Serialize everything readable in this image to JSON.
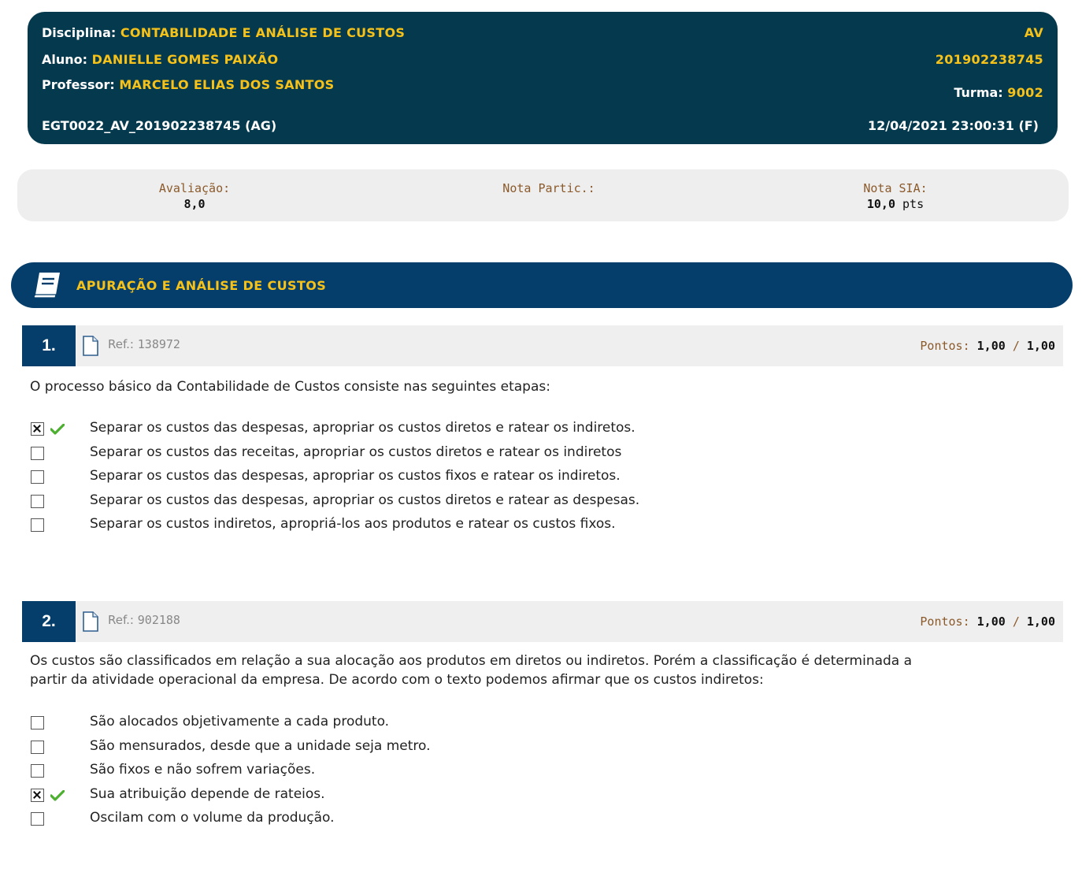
{
  "header": {
    "disciplina_label": "Disciplina:",
    "disciplina": "CONTABILIDADE E ANÁLISE DE CUSTOS",
    "aluno_label": "Aluno:",
    "aluno": "DANIELLE GOMES PAIXÃO",
    "professor_label": "Professor:",
    "professor": "MARCELO ELIAS DOS SANTOS",
    "code": "EGT0022_AV_201902238745 (AG)",
    "av": "AV",
    "matricula": "201902238745",
    "turma_label": "Turma:",
    "turma": "9002",
    "datetime": "12/04/2021 23:00:31 (F)",
    "bg_color": "#053a4e",
    "accent_color": "#f6c21a"
  },
  "grades": {
    "avaliacao_label": "Avaliação:",
    "avaliacao": "8,0",
    "nota_partic_label": "Nota Partic.:",
    "nota_sia_label": "Nota SIA:",
    "nota_sia": "10,0",
    "nota_sia_unit": "pts"
  },
  "section": {
    "title": "APURAÇÃO E ANÁLISE DE CUSTOS",
    "icon": "book-icon",
    "bg_color": "#053e6b"
  },
  "questions": [
    {
      "number": "1.",
      "ref_label": "Ref.:",
      "ref": "138972",
      "points_label": "Pontos:",
      "points": "1,00",
      "points_sep": "/",
      "points_max": "1,00",
      "text": "O processo básico da Contabilidade de Custos consiste nas seguintes etapas:",
      "options": [
        {
          "text": "Separar os custos das despesas, apropriar os custos diretos e ratear os indiretos.",
          "checked": true,
          "correct": true
        },
        {
          "text": "Separar os custos das receitas, apropriar os custos diretos e ratear os indiretos",
          "checked": false,
          "correct": false
        },
        {
          "text": "Separar os custos das despesas, apropriar os custos fixos e ratear os indiretos.",
          "checked": false,
          "correct": false
        },
        {
          "text": "Separar os custos das despesas, apropriar os custos diretos e ratear as despesas.",
          "checked": false,
          "correct": false
        },
        {
          "text": "Separar os custos indiretos, apropriá-los aos produtos e ratear os custos fixos.",
          "checked": false,
          "correct": false
        }
      ]
    },
    {
      "number": "2.",
      "ref_label": "Ref.:",
      "ref": "902188",
      "points_label": "Pontos:",
      "points": "1,00",
      "points_sep": "/",
      "points_max": "1,00",
      "text_line1": "Os custos são classificados em relação a sua alocação aos produtos em diretos ou indiretos. Porém a classificação é determinada a",
      "text_line2": "partir da atividade operacional da empresa. De acordo com o texto podemos afirmar que os custos indiretos:",
      "options": [
        {
          "text": "São alocados objetivamente a cada produto.",
          "checked": false,
          "correct": false
        },
        {
          "text": "São mensurados, desde que a unidade seja metro.",
          "checked": false,
          "correct": false
        },
        {
          "text": "São fixos e não sofrem variações.",
          "checked": false,
          "correct": false
        },
        {
          "text": "Sua atribuição depende de rateios.",
          "checked": true,
          "correct": true
        },
        {
          "text": "Oscilam com o volume da produção.",
          "checked": false,
          "correct": false
        }
      ]
    }
  ]
}
